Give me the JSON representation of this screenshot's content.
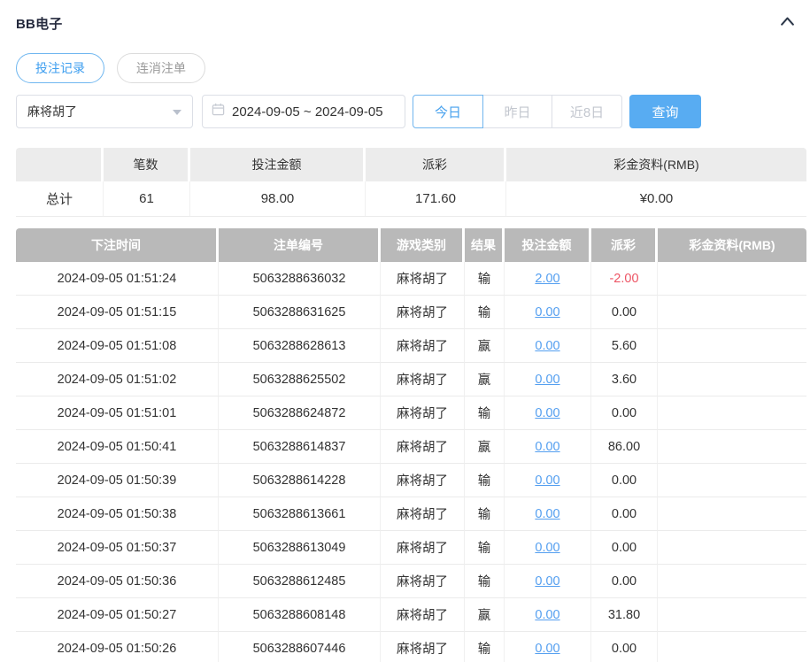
{
  "header": {
    "title": "BB电子",
    "collapse_icon": "chevron-up"
  },
  "tabs": [
    {
      "label": "投注记录",
      "active": true
    },
    {
      "label": "连消注单",
      "active": false
    }
  ],
  "filters": {
    "game_select": {
      "value": "麻将胡了",
      "icon": "chevron-down"
    },
    "date_range": {
      "value": "2024-09-05 ~ 2024-09-05",
      "icon": "calendar"
    },
    "quick_buttons": [
      {
        "label": "今日",
        "active": true
      },
      {
        "label": "昨日",
        "active": false
      },
      {
        "label": "近8日",
        "active": false
      }
    ],
    "search_button_label": "查询"
  },
  "summary": {
    "headers": [
      "",
      "笔数",
      "投注金额",
      "派彩",
      "彩金资料(RMB)"
    ],
    "row": {
      "label": "总计",
      "count": "61",
      "bet_amount": "98.00",
      "payout": "171.60",
      "bonus": "¥0.00"
    }
  },
  "table": {
    "headers": [
      "下注时间",
      "注单编号",
      "游戏类别",
      "结果",
      "投注金额",
      "派彩",
      "彩金资料(RMB)"
    ],
    "rows": [
      {
        "time": "2024-09-05 01:51:24",
        "order_id": "5063288636032",
        "game": "麻将胡了",
        "result": "输",
        "bet_amount": "2.00",
        "payout": "-2.00",
        "bonus": ""
      },
      {
        "time": "2024-09-05 01:51:15",
        "order_id": "5063288631625",
        "game": "麻将胡了",
        "result": "输",
        "bet_amount": "0.00",
        "payout": "0.00",
        "bonus": ""
      },
      {
        "time": "2024-09-05 01:51:08",
        "order_id": "5063288628613",
        "game": "麻将胡了",
        "result": "赢",
        "bet_amount": "0.00",
        "payout": "5.60",
        "bonus": ""
      },
      {
        "time": "2024-09-05 01:51:02",
        "order_id": "5063288625502",
        "game": "麻将胡了",
        "result": "赢",
        "bet_amount": "0.00",
        "payout": "3.60",
        "bonus": ""
      },
      {
        "time": "2024-09-05 01:51:01",
        "order_id": "5063288624872",
        "game": "麻将胡了",
        "result": "输",
        "bet_amount": "0.00",
        "payout": "0.00",
        "bonus": ""
      },
      {
        "time": "2024-09-05 01:50:41",
        "order_id": "5063288614837",
        "game": "麻将胡了",
        "result": "赢",
        "bet_amount": "0.00",
        "payout": "86.00",
        "bonus": ""
      },
      {
        "time": "2024-09-05 01:50:39",
        "order_id": "5063288614228",
        "game": "麻将胡了",
        "result": "输",
        "bet_amount": "0.00",
        "payout": "0.00",
        "bonus": ""
      },
      {
        "time": "2024-09-05 01:50:38",
        "order_id": "5063288613661",
        "game": "麻将胡了",
        "result": "输",
        "bet_amount": "0.00",
        "payout": "0.00",
        "bonus": ""
      },
      {
        "time": "2024-09-05 01:50:37",
        "order_id": "5063288613049",
        "game": "麻将胡了",
        "result": "输",
        "bet_amount": "0.00",
        "payout": "0.00",
        "bonus": ""
      },
      {
        "time": "2024-09-05 01:50:36",
        "order_id": "5063288612485",
        "game": "麻将胡了",
        "result": "输",
        "bet_amount": "0.00",
        "payout": "0.00",
        "bonus": ""
      },
      {
        "time": "2024-09-05 01:50:27",
        "order_id": "5063288608148",
        "game": "麻将胡了",
        "result": "赢",
        "bet_amount": "0.00",
        "payout": "31.80",
        "bonus": ""
      },
      {
        "time": "2024-09-05 01:50:26",
        "order_id": "5063288607446",
        "game": "麻将胡了",
        "result": "输",
        "bet_amount": "0.00",
        "payout": "0.00",
        "bonus": ""
      }
    ]
  },
  "colors": {
    "accent": "#58acf2",
    "link": "#549ff0",
    "negative": "#ed5565",
    "table-header-bg": "#b9b9b9",
    "summary-header-bg": "#ececec"
  }
}
